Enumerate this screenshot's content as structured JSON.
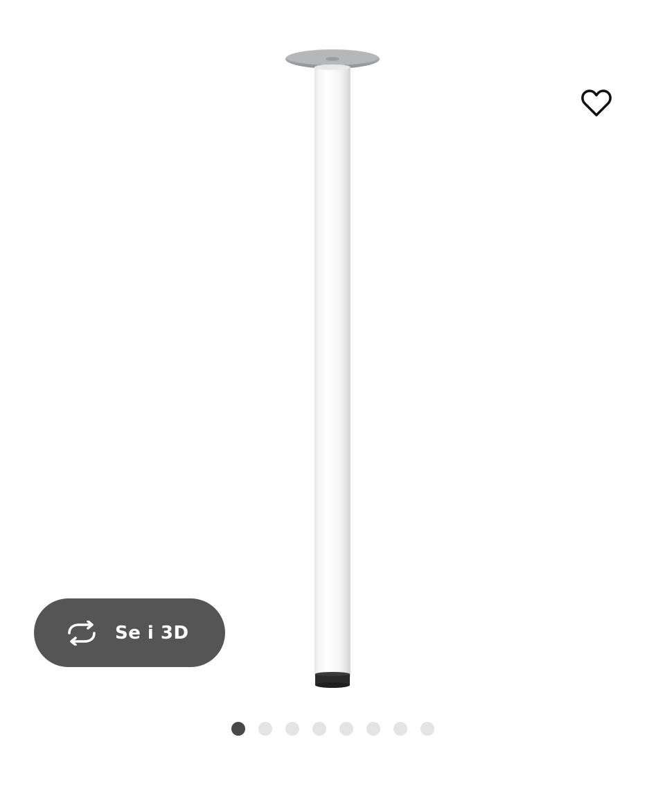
{
  "product": {
    "image_description_icon": "table-leg-image"
  },
  "favorite": {
    "icon": "heart-outline-icon"
  },
  "view_3d": {
    "label": "Se i 3D",
    "icon": "rotate-3d-icon",
    "background": "#555555"
  },
  "carousel": {
    "total_slides": 8,
    "active_index": 0,
    "active_color": "#484848",
    "inactive_color": "#e4e4e4"
  }
}
